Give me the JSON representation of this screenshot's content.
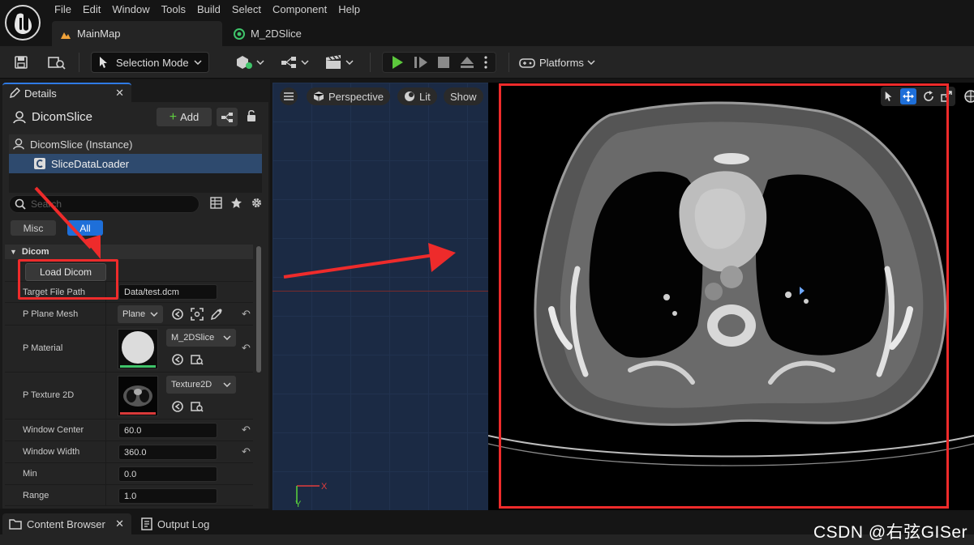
{
  "menubar": {
    "items": [
      "File",
      "Edit",
      "Window",
      "Tools",
      "Build",
      "Select",
      "Component",
      "Help"
    ]
  },
  "doc_tabs": [
    {
      "label": "MainMap",
      "icon": "level-icon"
    },
    {
      "label": "M_2DSlice",
      "icon": "material-icon"
    }
  ],
  "toolbar": {
    "selection_mode": "Selection Mode",
    "platforms": "Platforms"
  },
  "details": {
    "tab_label": "Details",
    "actor_name": "DicomSlice",
    "add_label": "Add",
    "tree": {
      "root": "DicomSlice (Instance)",
      "child": "SliceDataLoader"
    },
    "search_placeholder": "Search",
    "filters": [
      "Misc",
      "All"
    ],
    "category": "Dicom",
    "load_button": "Load Dicom",
    "properties": {
      "target_file_path": {
        "label": "Target File Path",
        "value": "Data/test.dcm"
      },
      "plane_mesh": {
        "label": "P Plane Mesh",
        "value": "Plane"
      },
      "material": {
        "label": "P Material",
        "value": "M_2DSlice"
      },
      "texture": {
        "label": "P Texture 2D",
        "value": "Texture2D"
      },
      "window_center": {
        "label": "Window Center",
        "value": "60.0"
      },
      "window_width": {
        "label": "Window Width",
        "value": "360.0"
      },
      "min": {
        "label": "Min",
        "value": "0.0"
      },
      "range": {
        "label": "Range",
        "value": "1.0"
      }
    }
  },
  "viewport": {
    "perspective": "Perspective",
    "lit": "Lit",
    "show": "Show",
    "gizmo_x": "X",
    "gizmo_y": "Y"
  },
  "bottom_tabs": {
    "content_browser": "Content Browser",
    "output_log": "Output Log"
  },
  "watermark": "CSDN @右弦GISer",
  "colors": {
    "accent": "#1e6fd9",
    "annotation": "#ee2b2b",
    "panel": "#242424"
  }
}
